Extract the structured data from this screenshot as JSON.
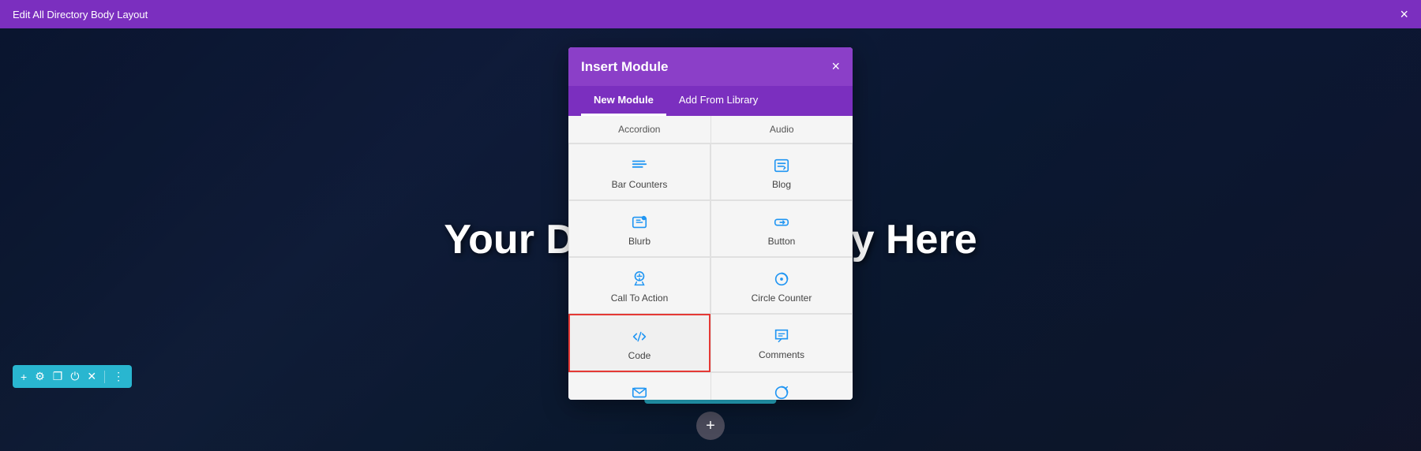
{
  "topBar": {
    "title": "Edit All Directory Body Layout",
    "closeLabel": "×"
  },
  "pageHeading": "Your Dynamic Display Here",
  "modal": {
    "title": "Insert Module",
    "closeLabel": "×",
    "tabs": [
      {
        "id": "new-module",
        "label": "New Module",
        "active": true
      },
      {
        "id": "add-from-library",
        "label": "Add From Library",
        "active": false
      }
    ],
    "partialTopItems": [
      {
        "label": "Accordion"
      },
      {
        "label": "Audio"
      }
    ],
    "modules": [
      {
        "id": "bar-counters",
        "label": "Bar Counters",
        "icon": "bars",
        "highlighted": false
      },
      {
        "id": "blog",
        "label": "Blog",
        "icon": "blog",
        "highlighted": false
      },
      {
        "id": "blurb",
        "label": "Blurb",
        "icon": "blurb",
        "highlighted": false
      },
      {
        "id": "button",
        "label": "Button",
        "icon": "button",
        "highlighted": false
      },
      {
        "id": "call-to-action",
        "label": "Call To Action",
        "icon": "cta",
        "highlighted": false
      },
      {
        "id": "circle-counter",
        "label": "Circle Counter",
        "icon": "circle",
        "highlighted": false
      },
      {
        "id": "code",
        "label": "Code",
        "icon": "code",
        "highlighted": true
      },
      {
        "id": "comments",
        "label": "Comments",
        "icon": "comments",
        "highlighted": false
      }
    ],
    "partialBottomItems": [
      {
        "label": "✉",
        "icon": "email"
      },
      {
        "label": "↻",
        "icon": "counter"
      }
    ]
  },
  "bottomToolbarLeft": {
    "icons": [
      "+",
      "⚙",
      "❐",
      "⏻",
      "✕",
      "⋮"
    ]
  },
  "bottomToolbarCenter": {
    "icons": [
      "+",
      "⚙",
      "❐",
      "▦",
      "⏻",
      "✕",
      "⋮"
    ]
  },
  "plusButton": "+"
}
